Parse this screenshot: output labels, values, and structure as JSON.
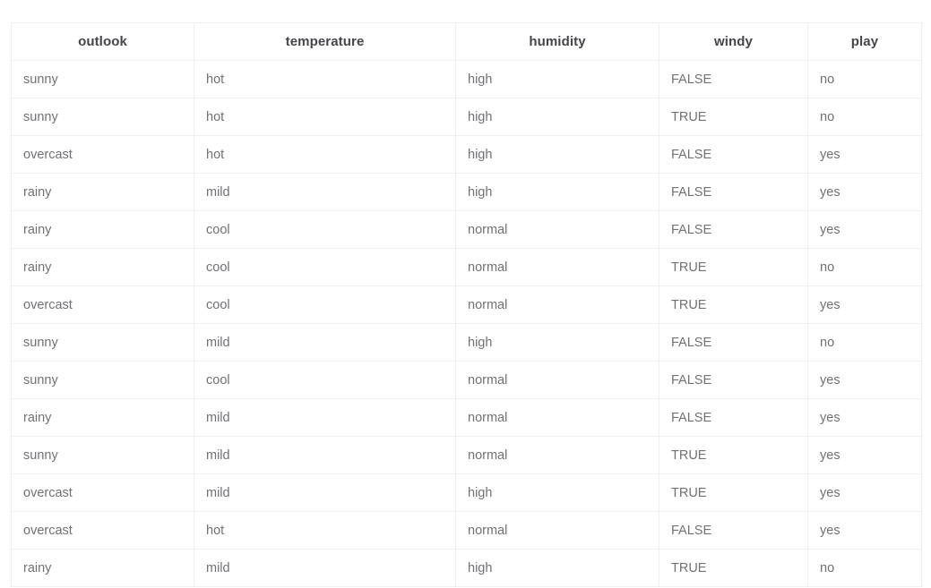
{
  "table": {
    "columns": [
      {
        "key": "outlook",
        "label": "outlook"
      },
      {
        "key": "temperature",
        "label": "temperature"
      },
      {
        "key": "humidity",
        "label": "humidity"
      },
      {
        "key": "windy",
        "label": "windy"
      },
      {
        "key": "play",
        "label": "play"
      }
    ],
    "rows": [
      [
        "sunny",
        "hot",
        "high",
        "FALSE",
        "no"
      ],
      [
        "sunny",
        "hot",
        "high",
        "TRUE",
        "no"
      ],
      [
        "overcast",
        "hot",
        "high",
        "FALSE",
        "yes"
      ],
      [
        "rainy",
        "mild",
        "high",
        "FALSE",
        "yes"
      ],
      [
        "rainy",
        "cool",
        "normal",
        "FALSE",
        "yes"
      ],
      [
        "rainy",
        "cool",
        "normal",
        "TRUE",
        "no"
      ],
      [
        "overcast",
        "cool",
        "normal",
        "TRUE",
        "yes"
      ],
      [
        "sunny",
        "mild",
        "high",
        "FALSE",
        "no"
      ],
      [
        "sunny",
        "cool",
        "normal",
        "FALSE",
        "yes"
      ],
      [
        "rainy",
        "mild",
        "normal",
        "FALSE",
        "yes"
      ],
      [
        "sunny",
        "mild",
        "normal",
        "TRUE",
        "yes"
      ],
      [
        "overcast",
        "mild",
        "high",
        "TRUE",
        "yes"
      ],
      [
        "overcast",
        "hot",
        "normal",
        "FALSE",
        "yes"
      ],
      [
        "rainy",
        "mild",
        "high",
        "TRUE",
        "no"
      ]
    ],
    "row_count": 14,
    "column_count": 5,
    "colors": {
      "header_text": "#43454a",
      "cell_text": "#6f7175",
      "border": "#efeff1",
      "background": "#ffffff"
    }
  }
}
